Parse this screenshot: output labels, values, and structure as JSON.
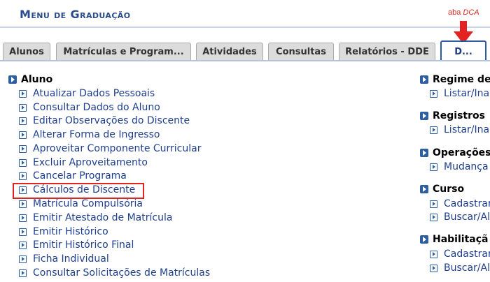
{
  "header": {
    "title": "Menu de Graduação",
    "annotation_prefix": "aba ",
    "annotation_emph": "DCA"
  },
  "tabs": [
    {
      "label": "Alunos",
      "active": false
    },
    {
      "label": "Matrículas e Program...",
      "active": false
    },
    {
      "label": "Atividades",
      "active": false
    },
    {
      "label": "Consultas",
      "active": false
    },
    {
      "label": "Relatórios - DDE",
      "active": false
    },
    {
      "label": "D...",
      "active": true
    }
  ],
  "left_section": {
    "heading": "Aluno",
    "items": [
      "Atualizar Dados Pessoais",
      "Consultar Dados do Aluno",
      "Editar Observações do Discente",
      "Alterar Forma de Ingresso",
      "Aproveitar Componente Curricular",
      "Excluir Aproveitamento",
      "Cancelar Programa",
      "Cálculos de Discente",
      "Matrícula Compulsória",
      "Emitir Atestado de Matrícula",
      "Emitir Histórico",
      "Emitir Histórico Final",
      "Ficha Individual",
      "Consultar Solicitações de Matrículas"
    ],
    "highlighted_index": 7
  },
  "right_sections": [
    {
      "heading": "Regime de",
      "items": [
        "Listar/Ina"
      ]
    },
    {
      "heading": "Registros",
      "items": [
        "Listar/Ina"
      ]
    },
    {
      "heading": "Operações",
      "items": [
        "Mudança"
      ]
    },
    {
      "heading": "Curso",
      "items": [
        "Cadastrar",
        "Buscar/Al"
      ]
    },
    {
      "heading": "Habilitaçã",
      "items": [
        "Cadastrar",
        "Buscar/Al"
      ]
    }
  ],
  "colors": {
    "title": "#2b4c8c",
    "link": "#1f3f8c",
    "annotation": "#d9281c",
    "highlight": "#e02424"
  }
}
